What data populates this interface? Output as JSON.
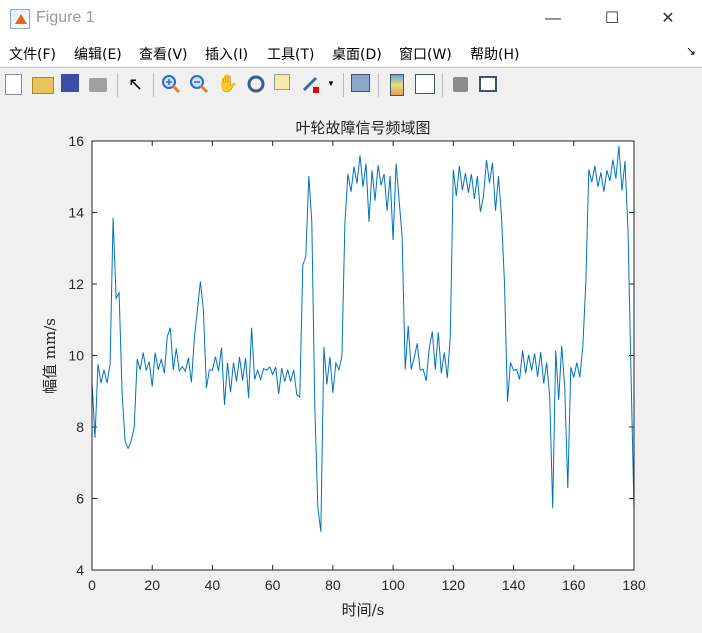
{
  "window": {
    "title": "Figure 1",
    "minimize": "—",
    "maximize": "☐",
    "close": "✕"
  },
  "menu": [
    "文件(F)",
    "编辑(E)",
    "查看(V)",
    "插入(I)",
    "工具(T)",
    "桌面(D)",
    "窗口(W)",
    "帮助(H)"
  ],
  "menu_arrow": "↘",
  "toolbar": [
    "new-figure",
    "open-file",
    "save",
    "print",
    "edit-plot-pointer",
    "zoom-in",
    "zoom-out",
    "pan",
    "rotate-3d",
    "data-cursor",
    "brush",
    "brush-dropdown",
    "link-plot",
    "insert-colorbar",
    "insert-legend",
    "hide-plot-tools",
    "show-plot-tools"
  ],
  "colors": {
    "line": "#0072bd",
    "figure_bg": "#f0f0f0",
    "axes_bg": "#ffffff"
  },
  "chart_data": {
    "type": "line",
    "title": "叶轮故障信号频域图",
    "xlabel": "时间/s",
    "ylabel": "幅值 mm/s",
    "xlim": [
      0,
      180
    ],
    "ylim": [
      4,
      16
    ],
    "xticks": [
      0,
      20,
      40,
      60,
      80,
      100,
      120,
      140,
      160,
      180
    ],
    "yticks": [
      4,
      6,
      8,
      10,
      12,
      14,
      16
    ],
    "grid": false,
    "x_start": 0,
    "x_step": 1,
    "values": [
      9.27,
      7.7,
      9.76,
      9.23,
      9.6,
      9.23,
      9.76,
      13.85,
      11.6,
      11.75,
      8.95,
      7.6,
      7.4,
      7.6,
      8.0,
      9.9,
      9.6,
      10.08,
      9.58,
      9.83,
      9.13,
      10.08,
      9.6,
      9.9,
      9.5,
      10.53,
      10.78,
      9.6,
      10.2,
      9.57,
      9.69,
      9.56,
      9.93,
      9.25,
      10.5,
      11.27,
      12.07,
      11.27,
      9.09,
      9.6,
      9.59,
      9.97,
      9.56,
      10.22,
      8.62,
      9.8,
      8.97,
      9.8,
      9.27,
      9.96,
      9.3,
      9.93,
      8.81,
      10.78,
      9.33,
      9.59,
      9.33,
      9.63,
      9.59,
      9.68,
      9.47,
      9.68,
      8.92,
      9.65,
      9.27,
      9.6,
      9.27,
      9.6,
      8.9,
      8.84,
      12.53,
      12.76,
      15.02,
      13.74,
      8.57,
      5.77,
      5.07,
      10.24,
      9.19,
      9.96,
      8.95,
      9.79,
      9.6,
      9.98,
      13.7,
      15.08,
      14.58,
      15.28,
      14.81,
      15.6,
      14.72,
      15.37,
      13.74,
      15.18,
      14.33,
      15.32,
      14.76,
      15.08,
      14.05,
      15.02,
      13.23,
      15.37,
      14.35,
      13.33,
      9.61,
      10.83,
      9.61,
      9.93,
      10.34,
      9.59,
      9.62,
      9.29,
      10.2,
      10.67,
      9.61,
      10.65,
      9.5,
      10.09,
      9.37,
      10.53,
      15.2,
      14.46,
      15.3,
      14.63,
      15.1,
      14.55,
      15.08,
      14.38,
      15.02,
      14.02,
      14.43,
      15.47,
      14.83,
      15.39,
      14.05,
      15.02,
      13.87,
      12.02,
      8.71,
      9.8,
      9.58,
      9.61,
      9.33,
      10.14,
      9.5,
      10.02,
      9.58,
      10.06,
      9.4,
      10.1,
      9.22,
      9.8,
      8.85,
      5.73,
      10.14,
      8.76,
      10.27,
      9.13,
      6.29,
      9.67,
      9.39,
      9.8,
      9.39,
      10.24,
      12.02,
      15.2,
      14.85,
      15.3,
      14.72,
      15.12,
      14.58,
      15.18,
      14.88,
      15.48,
      14.95,
      15.86,
      14.61,
      15.44,
      13.5,
      9.5,
      5.7
    ]
  }
}
